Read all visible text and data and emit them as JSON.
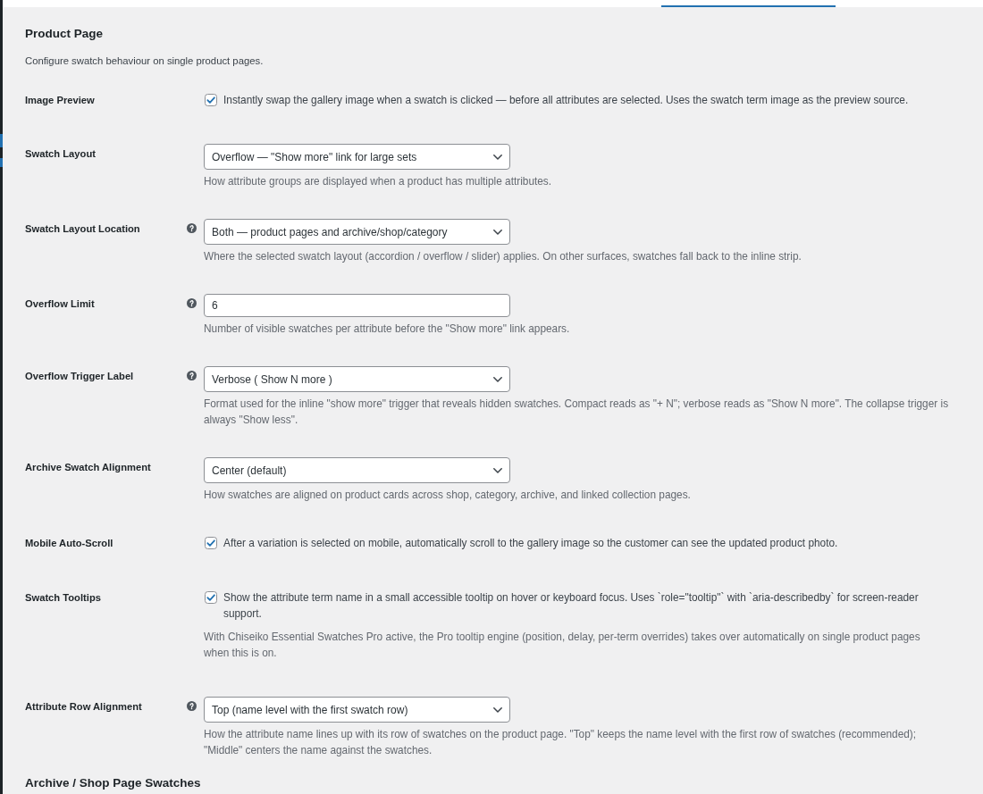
{
  "section": {
    "title": "Product Page",
    "description": "Configure swatch behaviour on single product pages."
  },
  "settings": [
    {
      "kind": "checkbox",
      "label": "Image Preview",
      "help": false,
      "checked": true,
      "text": "Instantly swap the gallery image when a swatch is clicked — before all attributes are selected. Uses the swatch term image as the preview source."
    },
    {
      "kind": "select",
      "label": "Swatch Layout",
      "help": false,
      "value": "Overflow — \"Show more\" link for large sets",
      "description": "How attribute groups are displayed when a product has multiple attributes."
    },
    {
      "kind": "select",
      "label": "Swatch Layout Location",
      "help": true,
      "value": "Both — product pages and archive/shop/category",
      "description": "Where the selected swatch layout (accordion / overflow / slider) applies. On other surfaces, swatches fall back to the inline strip."
    },
    {
      "kind": "number",
      "label": "Overflow Limit",
      "help": true,
      "value": "6",
      "description": "Number of visible swatches per attribute before the \"Show more\" link appears."
    },
    {
      "kind": "select",
      "label": "Overflow Trigger Label",
      "help": true,
      "value": "Verbose ( Show N more )",
      "description": "Format used for the inline \"show more\" trigger that reveals hidden swatches. Compact reads as \"+ N\"; verbose reads as \"Show N more\". The collapse trigger is always \"Show less\"."
    },
    {
      "kind": "select",
      "label": "Archive Swatch Alignment",
      "help": false,
      "value": "Center (default)",
      "description": "How swatches are aligned on product cards across shop, category, archive, and linked collection pages."
    },
    {
      "kind": "checkbox",
      "label": "Mobile Auto-Scroll",
      "help": false,
      "checked": true,
      "text": "After a variation is selected on mobile, automatically scroll to the gallery image so the customer can see the updated product photo."
    },
    {
      "kind": "checkbox",
      "label": "Swatch Tooltips",
      "help": false,
      "checked": true,
      "text": "Show the attribute term name in a small accessible tooltip on hover or keyboard focus. Uses `role=\"tooltip\"` with `aria-describedby` for screen-reader support.",
      "note": "With Chiseiko Essential Swatches Pro active, the Pro tooltip engine (position, delay, per-term overrides) takes over automatically on single product pages when this is on."
    },
    {
      "kind": "select",
      "label": "Attribute Row Alignment",
      "help": true,
      "value": "Top (name level with the first swatch row)",
      "description": "How the attribute name lines up with its row of swatches on the product page. \"Top\" keeps the name level with the first row of swatches (recommended); \"Middle\" centers the name against the swatches."
    }
  ],
  "next_section": {
    "title": "Archive / Shop Page Swatches"
  }
}
